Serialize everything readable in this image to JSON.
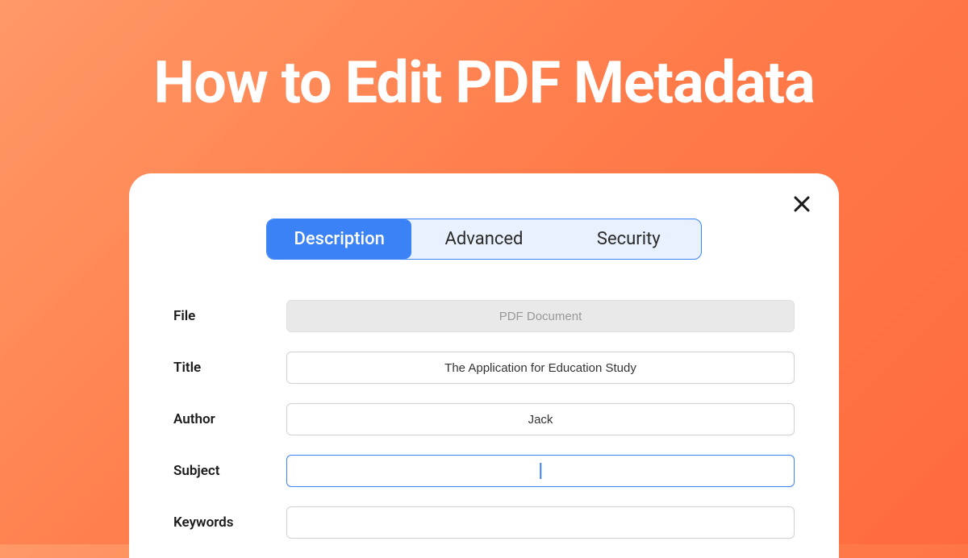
{
  "page": {
    "title": "How to Edit PDF Metadata"
  },
  "dialog": {
    "tabs": {
      "description": "Description",
      "advanced": "Advanced",
      "security": "Security"
    },
    "fields": {
      "file": {
        "label": "File",
        "value": "PDF Document"
      },
      "title": {
        "label": "Title",
        "value": "The Application for Education Study"
      },
      "author": {
        "label": "Author",
        "value": "Jack"
      },
      "subject": {
        "label": "Subject",
        "value": ""
      },
      "keywords": {
        "label": "Keywords",
        "value": ""
      }
    }
  }
}
